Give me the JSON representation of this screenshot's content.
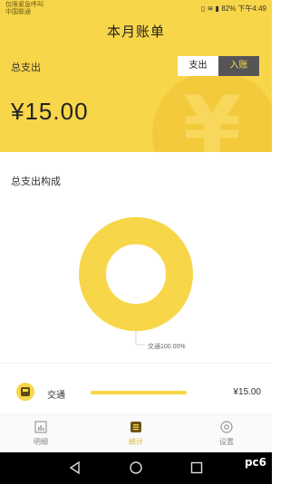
{
  "status_bar": {
    "carrier_line1": "仅限紧急呼叫",
    "carrier_line2": "中国联通",
    "right": "82% 下午4:49"
  },
  "header": {
    "title": "本月账单",
    "total_label": "总支出",
    "toggle": {
      "expense": "支出",
      "income": "入账"
    },
    "total_amount": "¥15.00",
    "watermark_glyph": "¥"
  },
  "composition": {
    "title": "总支出构成",
    "pie_label": "交通100.00%",
    "categories": [
      {
        "name": "交通",
        "amount": "¥15.00",
        "share": 1.0,
        "icon": "bus-icon"
      }
    ]
  },
  "chart_data": {
    "type": "pie",
    "categories": [
      "交通"
    ],
    "values": [
      100.0
    ],
    "title": "总支出构成"
  },
  "tabs": [
    {
      "label": "明细",
      "icon": "list-icon"
    },
    {
      "label": "统计",
      "icon": "stats-icon",
      "active": true
    },
    {
      "label": "设置",
      "icon": "settings-icon"
    }
  ],
  "watermark": "pc6",
  "colors": {
    "accent": "#f8d64a",
    "dark_toggle": "#555555"
  }
}
